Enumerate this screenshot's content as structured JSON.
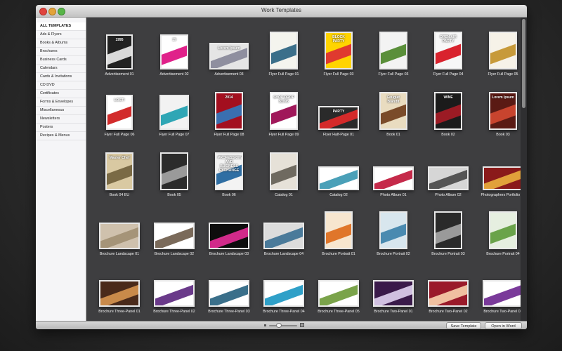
{
  "window": {
    "title": "Work Templates"
  },
  "sidebar": {
    "items": [
      {
        "label": "ALL TEMPLATES",
        "selected": true
      },
      {
        "label": "Ads & Flyers"
      },
      {
        "label": "Books & Albums"
      },
      {
        "label": "Brochures"
      },
      {
        "label": "Business Cards"
      },
      {
        "label": "Calendars"
      },
      {
        "label": "Cards & Invitations"
      },
      {
        "label": "CD DVD"
      },
      {
        "label": "Certificates"
      },
      {
        "label": "Forms & Envelopes"
      },
      {
        "label": "Miscellaneous"
      },
      {
        "label": "Newsletters"
      },
      {
        "label": "Posters"
      },
      {
        "label": "Recipes & Menus"
      }
    ]
  },
  "templates": [
    {
      "name": "Advertisement 01",
      "colors": [
        "#222222",
        "#d9d9d9"
      ],
      "text": "1995"
    },
    {
      "name": "Advertisement 02",
      "colors": [
        "#ffffff",
        "#e0218a"
      ],
      "text": "19"
    },
    {
      "name": "Advertisement 03",
      "colors": [
        "#e5e5e5",
        "#8f8f9f"
      ],
      "text": "Lorem Ipsum"
    },
    {
      "name": "Flyer Full Page 01",
      "colors": [
        "#f4f4ee",
        "#3b6f8a"
      ],
      "text": ""
    },
    {
      "name": "Flyer Full Page 03",
      "colors": [
        "#ffd400",
        "#e03a2f"
      ],
      "text": "BLOCK PARTY"
    },
    {
      "name": "Flyer Full Page 03",
      "colors": [
        "#f3f3f3",
        "#5a8f3a"
      ],
      "text": ""
    },
    {
      "name": "Flyer Full Page 04",
      "colors": [
        "#f7f7f7",
        "#d9232e"
      ],
      "text": "OPEN AIR PARTY"
    },
    {
      "name": "Flyer Full Page 05",
      "colors": [
        "#f6f2e8",
        "#c79a3a"
      ],
      "text": ""
    },
    {
      "name": "Flyer Full Page 06",
      "colors": [
        "#ffffff",
        "#d22b2b"
      ],
      "text": "LOST!"
    },
    {
      "name": "Flyer Full Page 07",
      "colors": [
        "#f2f2f2",
        "#2fa6b5"
      ],
      "text": ""
    },
    {
      "name": "Flyer Full Page 08",
      "colors": [
        "#a30f1f",
        "#3a6fb0"
      ],
      "text": "2014"
    },
    {
      "name": "Flyer Full Page 09",
      "colors": [
        "#ffffff",
        "#a0185a"
      ],
      "text": "SHOP DROP $1995"
    },
    {
      "name": "Flyer Half-Page 01",
      "colors": [
        "#2a2a2a",
        "#d42a2a"
      ],
      "text": "PARTY"
    },
    {
      "name": "Book 01",
      "colors": [
        "#e9dcc0",
        "#7a4b2a"
      ],
      "text": "Feugiat Blandit"
    },
    {
      "name": "Book 02",
      "colors": [
        "#1b1b1b",
        "#9b1b24"
      ],
      "text": "WINE"
    },
    {
      "name": "Book 03",
      "colors": [
        "#5a1a14",
        "#c8442e"
      ],
      "text": "Lorem Ipsum"
    },
    {
      "name": "Book 04 EU",
      "colors": [
        "#d9c9a2",
        "#7a6a45"
      ],
      "text": "Master Chef"
    },
    {
      "name": "Book 05",
      "colors": [
        "#2b2b2b",
        "#9a9a9a"
      ],
      "text": ""
    },
    {
      "name": "Book 06",
      "colors": [
        "#f3f3f3",
        "#2f6ea3"
      ],
      "text": "PROFESSIONAL AND BUSINESS EXCHANGE"
    },
    {
      "name": "Catalog 01",
      "colors": [
        "#e6e1d8",
        "#6f6a60"
      ],
      "text": ""
    },
    {
      "name": "Catalog 02",
      "colors": [
        "#ffffff",
        "#4aa0b8"
      ],
      "text": ""
    },
    {
      "name": "Photo Album 01",
      "colors": [
        "#ffffff",
        "#c52a4a"
      ],
      "text": ""
    },
    {
      "name": "Photo Album 02",
      "colors": [
        "#d6d6d6",
        "#555555"
      ],
      "text": ""
    },
    {
      "name": "Photographers Portfolio 01",
      "colors": [
        "#8a1a1a",
        "#e1a13a"
      ],
      "text": ""
    },
    {
      "name": "Brochure Landscape 01",
      "colors": [
        "#cfc1ad",
        "#a59478"
      ],
      "text": ""
    },
    {
      "name": "Brochure Landscape 02",
      "colors": [
        "#ffffff",
        "#7a6a5a"
      ],
      "text": ""
    },
    {
      "name": "Brochure Landscape 03",
      "colors": [
        "#0d0d0d",
        "#d12a8a"
      ],
      "text": ""
    },
    {
      "name": "Brochure Landscape 04",
      "colors": [
        "#dcdcdc",
        "#4a7a9a"
      ],
      "text": ""
    },
    {
      "name": "Brochure Portrait 01",
      "colors": [
        "#f7e6cf",
        "#e0762a"
      ],
      "text": ""
    },
    {
      "name": "Brochure Portrait 02",
      "colors": [
        "#d8e6ee",
        "#4a8ab0"
      ],
      "text": ""
    },
    {
      "name": "Brochure Portrait 03",
      "colors": [
        "#2a2a2a",
        "#9a9a9a"
      ],
      "text": ""
    },
    {
      "name": "Brochure Portrait 04",
      "colors": [
        "#e6efe0",
        "#6aa34a"
      ],
      "text": ""
    },
    {
      "name": "Brochure Three-Panel 01",
      "colors": [
        "#4a2a1a",
        "#c98a4a"
      ],
      "text": ""
    },
    {
      "name": "Brochure Three-Panel 02",
      "colors": [
        "#ffffff",
        "#6a3a8a"
      ],
      "text": ""
    },
    {
      "name": "Brochure Three-Panel 03",
      "colors": [
        "#ffffff",
        "#3a6f8a"
      ],
      "text": ""
    },
    {
      "name": "Brochure Three-Panel 04",
      "colors": [
        "#ffffff",
        "#2fa0c8"
      ],
      "text": ""
    },
    {
      "name": "Brochure Three-Panel 05",
      "colors": [
        "#ffffff",
        "#7aa34a"
      ],
      "text": ""
    },
    {
      "name": "Brochure Two-Panel 01",
      "colors": [
        "#3a1a4a",
        "#d0c0e0"
      ],
      "text": ""
    },
    {
      "name": "Brochure Two-Panel 02",
      "colors": [
        "#9a1a2a",
        "#f0c0a0"
      ],
      "text": ""
    },
    {
      "name": "Brochure Two-Panel 03",
      "colors": [
        "#ffffff",
        "#7a3a9a"
      ],
      "text": ""
    }
  ],
  "footer": {
    "save_label": "Save Template",
    "open_label": "Open in Word"
  }
}
